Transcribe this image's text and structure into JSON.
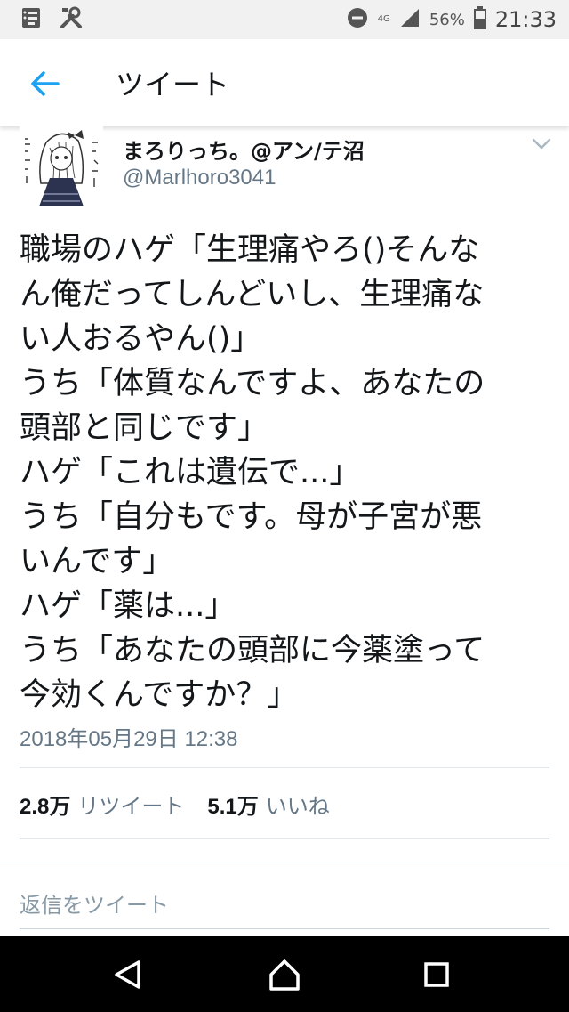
{
  "status_bar": {
    "network_label": "4G",
    "battery_percent": "56%",
    "time": "21:33"
  },
  "header": {
    "title": "ツイート"
  },
  "tweet": {
    "display_name": "まろりっち。@アン/テ沼",
    "handle": "@Marlhoro3041",
    "text_lines": [
      "職場のハゲ「生理痛やろ()そんなん俺だってしんどいし、生理痛ない人おるやん()」",
      "うち「体質なんですよ、あなたの頭部と同じです」",
      "ハゲ「これは遺伝で...」",
      "うち「自分もです。母が子宮が悪いんです」",
      "ハゲ「薬は...」",
      "うち「あなたの頭部に今薬塗って今効くんですか？」"
    ],
    "display_lines": [
      "職場のハゲ「生理痛やろ()そんな",
      "ん俺だってしんどいし、生理痛な",
      "い人おるやん()」",
      "うち「体質なんですよ、あなたの",
      "頭部と同じです」",
      "ハゲ「これは遺伝で...」",
      "うち「自分もです。母が子宮が悪",
      "いんです」",
      "ハゲ「薬は...」",
      "うち「あなたの頭部に今薬塗って",
      "今効くんですか？」"
    ],
    "timestamp": "2018年05月29日 12:38",
    "retweets_count": "2.8万",
    "retweets_label": "リツイート",
    "likes_count": "5.1万",
    "likes_label": "いいね"
  },
  "reply": {
    "placeholder": "返信をツイート"
  },
  "colors": {
    "accent": "#1da1f2",
    "secondary_text": "#657786",
    "status_bar_bg": "#f1f1f1",
    "nav_bar_bg": "#000000"
  },
  "icons": [
    "notes-icon",
    "tools-icon",
    "dnd-icon",
    "signal-icon",
    "battery-icon",
    "back-arrow-icon",
    "chevron-down-icon",
    "nav-back-icon",
    "nav-home-icon",
    "nav-recents-icon"
  ]
}
